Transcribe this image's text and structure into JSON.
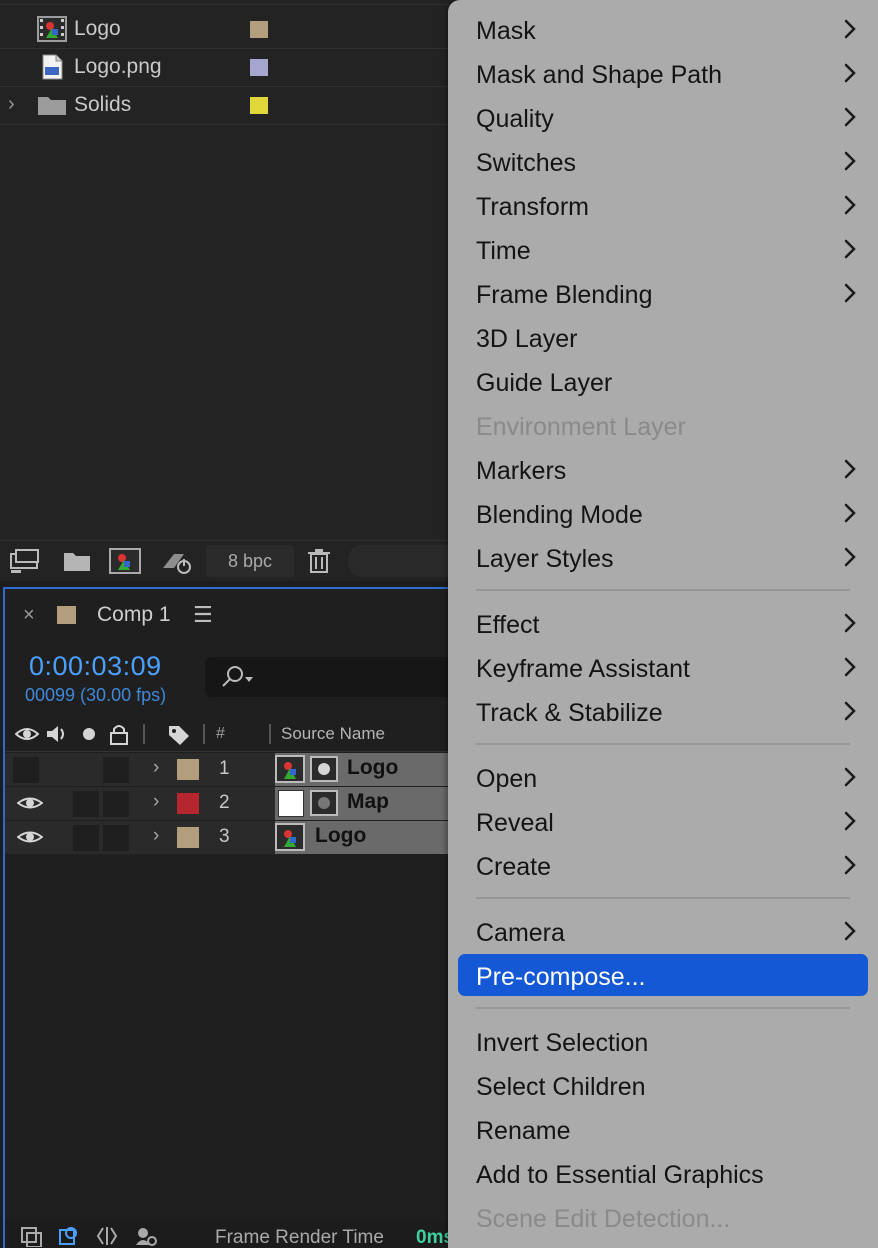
{
  "project": {
    "items": [
      {
        "name": "Logo",
        "type": "composition",
        "swatch": "#b29e7d"
      },
      {
        "name": "Logo.png",
        "type": "png",
        "swatch": "#a6a5cf"
      },
      {
        "name": "Solids",
        "type": "folder",
        "swatch": "#e2d73a"
      }
    ],
    "toolbar": {
      "bpc": "8 bpc"
    }
  },
  "timeline": {
    "tab_title": "Comp 1",
    "tab_swatch": "#b29e7d",
    "timecode": "0:00:03:09",
    "frame_info": "00099 (30.00 fps)",
    "columns": {
      "number": "#",
      "source_name": "Source Name"
    },
    "layers": [
      {
        "number": "1",
        "name": "Logo",
        "swatch": "#b29e7d",
        "visible": false
      },
      {
        "number": "2",
        "name": "Map",
        "swatch": "#b5262e",
        "visible": true
      },
      {
        "number": "3",
        "name": "Logo",
        "swatch": "#b29e7d",
        "visible": true
      }
    ],
    "footer": {
      "frame_render_label": "Frame Render Time",
      "frame_render_value": "0ms"
    }
  },
  "context_menu": {
    "items": [
      {
        "label": "Mask",
        "submenu": true
      },
      {
        "label": "Mask and Shape Path",
        "submenu": true
      },
      {
        "label": "Quality",
        "submenu": true
      },
      {
        "label": "Switches",
        "submenu": true
      },
      {
        "label": "Transform",
        "submenu": true
      },
      {
        "label": "Time",
        "submenu": true
      },
      {
        "label": "Frame Blending",
        "submenu": true
      },
      {
        "label": "3D Layer",
        "submenu": false
      },
      {
        "label": "Guide Layer",
        "submenu": false
      },
      {
        "label": "Environment Layer",
        "submenu": false,
        "disabled": true
      },
      {
        "label": "Markers",
        "submenu": true
      },
      {
        "label": "Blending Mode",
        "submenu": true
      },
      {
        "label": "Layer Styles",
        "submenu": true
      },
      {
        "label": "Effect",
        "submenu": true
      },
      {
        "label": "Keyframe Assistant",
        "submenu": true
      },
      {
        "label": "Track & Stabilize",
        "submenu": true
      },
      {
        "label": "Open",
        "submenu": true
      },
      {
        "label": "Reveal",
        "submenu": true
      },
      {
        "label": "Create",
        "submenu": true
      },
      {
        "label": "Camera",
        "submenu": true
      },
      {
        "label": "Pre-compose...",
        "submenu": false,
        "selected": true
      },
      {
        "label": "Invert Selection",
        "submenu": false
      },
      {
        "label": "Select Children",
        "submenu": false
      },
      {
        "label": "Rename",
        "submenu": false
      },
      {
        "label": "Add to Essential Graphics",
        "submenu": false
      },
      {
        "label": "Scene Edit Detection...",
        "submenu": false,
        "disabled": true
      }
    ]
  },
  "colors": {
    "accent_blue": "#4ba0ff",
    "menu_selected": "#1558d6",
    "menu_background": "#ababab",
    "render_time": "#3fd0a0"
  }
}
